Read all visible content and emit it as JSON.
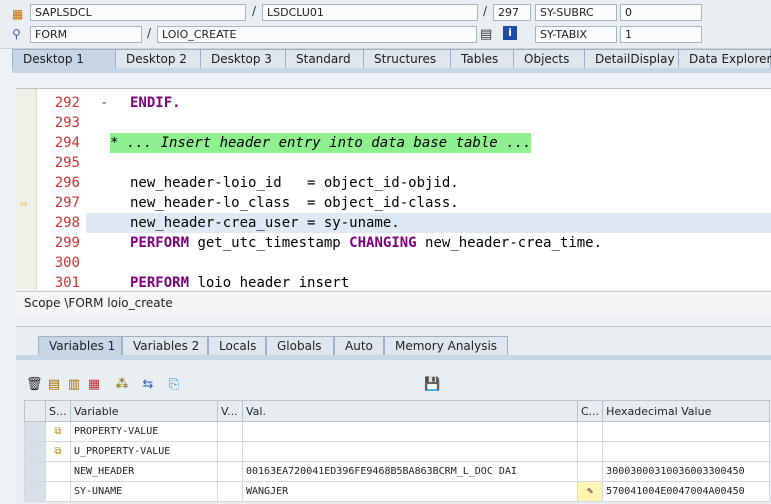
{
  "header": {
    "program": "SAPLSDCL",
    "include": "LSDCLU01",
    "line": "297",
    "subrc_label": "SY-SUBRC",
    "subrc_value": "0",
    "event_type": "FORM",
    "event_name": "LOIO_CREATE",
    "tabix_label": "SY-TABIX",
    "tabix_value": "1"
  },
  "desktop_tabs": [
    "Desktop 1",
    "Desktop 2",
    "Desktop 3",
    "Standard",
    "Structures",
    "Tables",
    "Objects",
    "DetailDisplay",
    "Data Explorer"
  ],
  "code": {
    "lines": [
      {
        "num": "292",
        "text": "ENDIF.",
        "kind": "kw"
      },
      {
        "num": "293",
        "text": "",
        "kind": "plain"
      },
      {
        "num": "294",
        "text": "* ... Insert header entry into data base table ...",
        "kind": "comment"
      },
      {
        "num": "295",
        "text": "",
        "kind": "plain"
      },
      {
        "num": "296",
        "text": "new_header-loio_id   = object_id-objid.",
        "kind": "plain"
      },
      {
        "num": "297",
        "text": "new_header-lo_class  = object_id-class.",
        "kind": "plain"
      },
      {
        "num": "298",
        "text": "new_header-crea_user = sy-uname.",
        "kind": "plain"
      },
      {
        "num": "299",
        "text": "PERFORM get_utc_timestamp CHANGING new_header-crea_time.",
        "kind": "perform"
      },
      {
        "num": "300",
        "text": "",
        "kind": "plain"
      },
      {
        "num": "301",
        "text": "PERFORM loio header insert",
        "kind": "perform"
      }
    ]
  },
  "scope_text": "Scope \\FORM loio_create",
  "var_tabs": [
    "Variables 1",
    "Variables 2",
    "Locals",
    "Globals",
    "Auto",
    "Memory Analysis"
  ],
  "table": {
    "headers": [
      "S...",
      "Variable",
      "V...",
      "Val.",
      "C...",
      "Hexadecimal Value"
    ],
    "rows": [
      {
        "variable": "PROPERTY-VALUE",
        "val": "",
        "hex": ""
      },
      {
        "variable": "U_PROPERTY-VALUE",
        "val": "",
        "hex": ""
      },
      {
        "variable": "NEW_HEADER",
        "val": "00163EA720041ED396FE9468B5BA863BCRM_L_DOC  DAI",
        "hex": "30003000310036003300450"
      },
      {
        "variable": "SY-UNAME",
        "val": "WANGJER",
        "hex": "570041004E0047004A00450"
      }
    ]
  }
}
